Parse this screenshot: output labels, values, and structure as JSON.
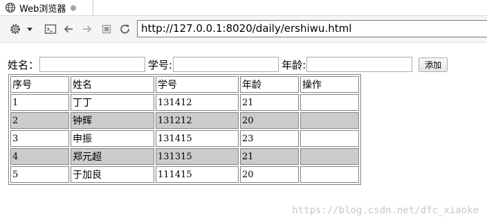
{
  "tab": {
    "title": "Web浏览器",
    "close": "⊗"
  },
  "toolbar": {
    "url": "http://127.0.0.1:8020/daily/ershiwu.html"
  },
  "form": {
    "name_label": "姓名：",
    "id_label": "学号:",
    "age_label": "年龄:",
    "name_value": "",
    "id_value": "",
    "age_value": "",
    "add_button": "添加"
  },
  "table": {
    "headers": [
      "序号",
      "姓名",
      "学号",
      "年龄",
      "操作"
    ],
    "rows": [
      {
        "no": "1",
        "name": "丁丁",
        "sid": "131412",
        "age": "21",
        "op": ""
      },
      {
        "no": "2",
        "name": "钟辉",
        "sid": "131212",
        "age": "20",
        "op": ""
      },
      {
        "no": "3",
        "name": "申振",
        "sid": "131415",
        "age": "23",
        "op": ""
      },
      {
        "no": "4",
        "name": "郑元超",
        "sid": "131315",
        "age": "21",
        "op": ""
      },
      {
        "no": "5",
        "name": "于加良",
        "sid": "111415",
        "age": "20",
        "op": ""
      }
    ]
  },
  "watermark": "https://blog.csdn.net/dfc_xiaoke",
  "icons": [
    "globe-icon",
    "close-icon",
    "gear-icon",
    "dropdown-icon",
    "terminal-icon",
    "back-icon",
    "forward-icon",
    "stop-icon",
    "reload-icon"
  ],
  "colors": {
    "alt_row": "#cccccc",
    "table_border": "#808080",
    "toolbar_bg": "#f5f5f5"
  }
}
